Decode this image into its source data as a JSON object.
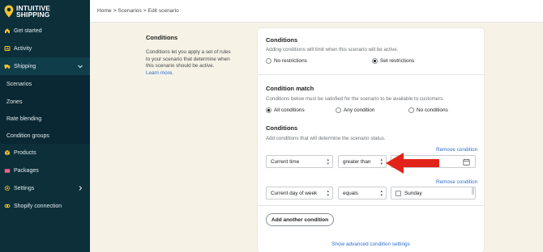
{
  "brand": {
    "line1": "INTUITIVE",
    "line2": "SHIPPING"
  },
  "sidebar": {
    "items": [
      {
        "label": "Get started",
        "icon": "home-icon"
      },
      {
        "label": "Activity",
        "icon": "activity-icon"
      },
      {
        "label": "Shipping",
        "icon": "truck-icon"
      },
      {
        "label": "Scenarios"
      },
      {
        "label": "Zones"
      },
      {
        "label": "Rate blending"
      },
      {
        "label": "Condition groups"
      },
      {
        "label": "Products",
        "icon": "box-icon"
      },
      {
        "label": "Packages",
        "icon": "package-icon"
      },
      {
        "label": "Settings",
        "icon": "gear-icon"
      },
      {
        "label": "Shopify connection",
        "icon": "link-icon"
      }
    ]
  },
  "breadcrumb": {
    "home": "Home",
    "sep": ">",
    "scenarios": "Scenarios",
    "current": "Edit scenario"
  },
  "left": {
    "title": "Conditions",
    "desc": "Conditions let you apply a set of rules to your scenario that determine when this scenario should be active.",
    "learn_more": "Learn more."
  },
  "card": {
    "conditions_title": "Conditions",
    "conditions_desc": "Adding conditions will limit when this scenario will be active.",
    "no_restrictions": "No restrictions",
    "set_restrictions": "Set restrictions",
    "match_title": "Condition match",
    "match_desc": "Conditions below must be satisfied for the scenario to be available to customers.",
    "all_conditions": "All conditions",
    "any_condition": "Any condition",
    "no_conditions": "No conditions",
    "cond_title": "Conditions",
    "cond_desc": "Add conditions that will determine the scenario status.",
    "remove": "Remove condition",
    "row1": {
      "field": "Current time",
      "operator": "greater than"
    },
    "row2": {
      "field": "Current day of week",
      "operator": "equals",
      "value": "Sunday"
    },
    "add_button": "Add another condition",
    "advanced_link": "Show advanced condition settings"
  },
  "colors": {
    "sidebar": "#0c2f3a",
    "accent": "#2c6ecb",
    "annotation_arrow": "#e2231a",
    "logo_pin": "#f2c230"
  }
}
